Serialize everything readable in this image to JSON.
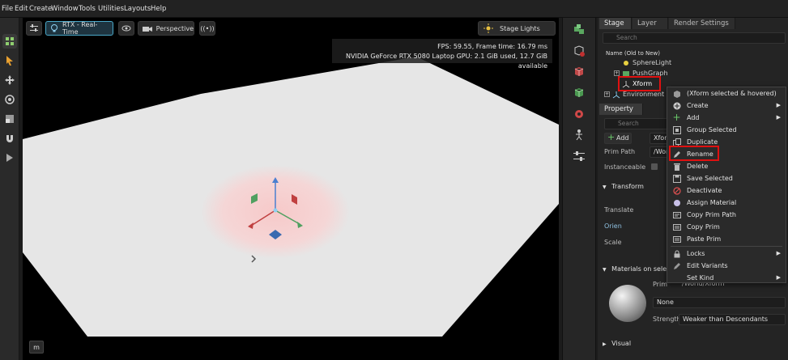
{
  "menubar": {
    "items": [
      "File",
      "Edit",
      "Create",
      "Window",
      "Tools",
      "Utilities",
      "Layouts",
      "Help"
    ]
  },
  "viewport": {
    "rtx_label": "RTX - Real-Time",
    "camera_label": "Perspective",
    "stage_lights_label": "Stage Lights",
    "fps_line": "FPS: 59.55, Frame time: 16.79 ms",
    "gpu_line": "NVIDIA GeForce RTX 5080 Laptop GPU: 2.1 GiB used, 12.7 GiB available",
    "m_label": "m"
  },
  "stage": {
    "tabs": [
      "Stage",
      "Layer",
      "Render Settings"
    ],
    "search_placeholder": "Search",
    "column_header": "Name (Old to New)",
    "tree": [
      {
        "label": "SphereLight"
      },
      {
        "label": "PushGraph"
      },
      {
        "label": "Xform"
      },
      {
        "label": "Environment"
      }
    ]
  },
  "property": {
    "tab": "Property",
    "search_placeholder": "Search",
    "add_label": "Add",
    "name_value": "Xfor",
    "prim_path_label": "Prim Path",
    "prim_path_value": "/Wor",
    "instanceable_label": "Instanceable",
    "transform_header": "Transform",
    "translate_label": "Translate",
    "orient_label": "Orien",
    "scale_label": "Scale",
    "materials_header": "Materials on select",
    "prim_label": "Prim",
    "prim_value": "/World/Xform",
    "material_value": "None",
    "strength_label": "Strength",
    "strength_value": "Weaker than Descendants",
    "visual_header": "Visual"
  },
  "context_menu": {
    "header": "(Xform selected & hovered)",
    "items": [
      {
        "label": "Create",
        "submenu": true
      },
      {
        "label": "Add",
        "submenu": true
      },
      {
        "label": "Group Selected",
        "submenu": false
      },
      {
        "label": "Duplicate",
        "submenu": false
      },
      {
        "label": "Rename",
        "submenu": false
      },
      {
        "label": "Delete",
        "submenu": false
      },
      {
        "label": "Save Selected",
        "submenu": false
      },
      {
        "label": "Deactivate",
        "submenu": false
      },
      {
        "label": "Assign Material",
        "submenu": false
      },
      {
        "label": "Copy Prim Path",
        "submenu": false
      },
      {
        "label": "Copy Prim",
        "submenu": false
      },
      {
        "label": "Paste Prim",
        "submenu": false
      },
      {
        "label": "Locks",
        "submenu": true
      },
      {
        "label": "Edit Variants",
        "submenu": false
      },
      {
        "label": "Set Kind",
        "submenu": true
      }
    ]
  },
  "colors": {
    "accent": "#4aa8c8",
    "highlight_box": "#e01010",
    "ground": "#e6e6e6",
    "light_glow": "#f7c9c9"
  }
}
